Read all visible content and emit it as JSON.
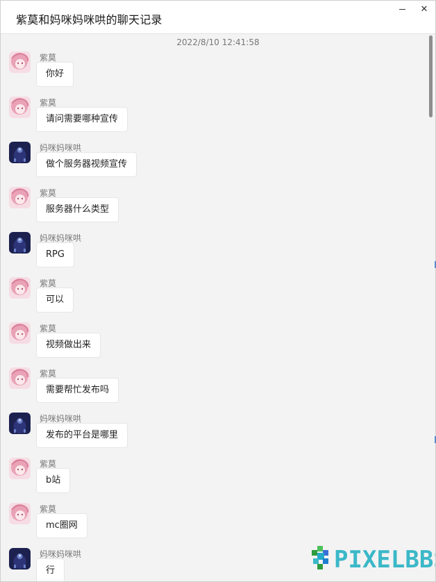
{
  "window": {
    "title": "紫莫和妈咪妈咪哄的聊天记录",
    "minimize_icon": "minimize-icon",
    "close_icon": "close-icon",
    "close_glyph": "✕"
  },
  "timestamp": "2022/8/10 12:41:58",
  "avatars": {
    "紫莫": {
      "icon": "pink-hair-avatar",
      "bg": "#f6dce4",
      "hair": "#e9a2b6",
      "face": "#fbe9ec"
    },
    "妈咪妈咪哄": {
      "icon": "dark-blue-avatar",
      "bg": "#1c2150",
      "accent": "#6a7fc8",
      "glow": "#cfd6f5"
    }
  },
  "messages": [
    {
      "sender": "紫莫",
      "text": "你好"
    },
    {
      "sender": "紫莫",
      "text": "请问需要哪种宣传"
    },
    {
      "sender": "妈咪妈咪哄",
      "text": "做个服务器视频宣传"
    },
    {
      "sender": "紫莫",
      "text": "服务器什么类型"
    },
    {
      "sender": "妈咪妈咪哄",
      "text": "RPG"
    },
    {
      "sender": "紫莫",
      "text": "可以"
    },
    {
      "sender": "紫莫",
      "text": "视频做出来"
    },
    {
      "sender": "紫莫",
      "text": "需要帮忙发布吗"
    },
    {
      "sender": "妈咪妈咪哄",
      "text": "发布的平台是哪里"
    },
    {
      "sender": "紫莫",
      "text": "b站"
    },
    {
      "sender": "紫莫",
      "text": "mc圈网"
    },
    {
      "sender": "妈咪妈咪哄",
      "text": "行"
    }
  ],
  "watermark": {
    "text": "PIXELBBS",
    "icon": "pixelbbs-logo-icon",
    "color": "#3bb8c8"
  }
}
